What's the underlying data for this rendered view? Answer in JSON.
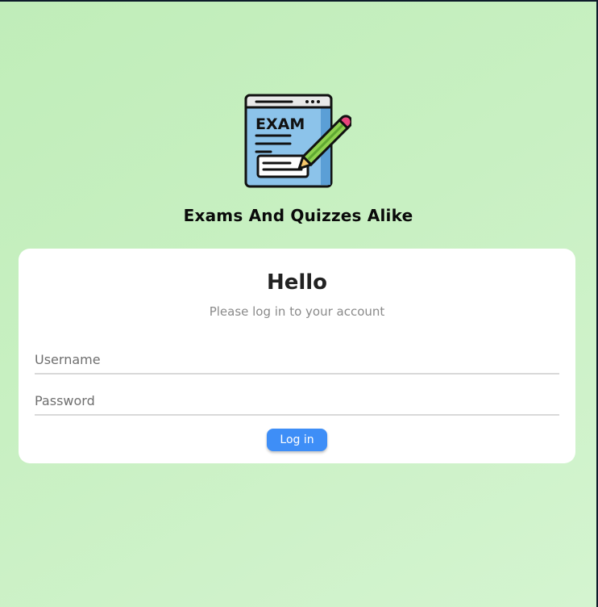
{
  "app": {
    "title": "Exams And Quizzes Alike",
    "logo_icon": "exam-document-pencil-icon",
    "logo_text": "EXAM"
  },
  "login_card": {
    "heading": "Hello",
    "subtitle": "Please log in to your account",
    "username_placeholder": "Username",
    "username_value": "",
    "password_placeholder": "Password",
    "password_value": "",
    "submit_label": "Log in"
  },
  "colors": {
    "background": "#c4eebd",
    "card": "#ffffff",
    "button": "#3e8ef7",
    "button_text": "#ffffff"
  }
}
